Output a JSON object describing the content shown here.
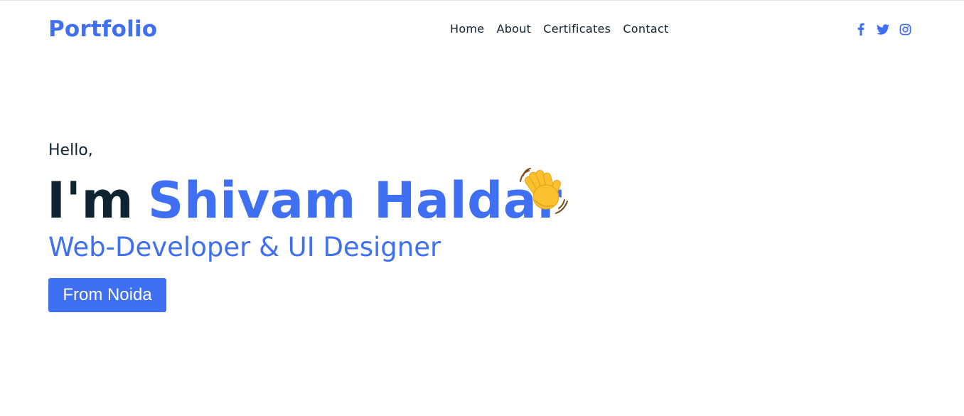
{
  "header": {
    "logo": "Portfolio",
    "nav": [
      "Home",
      "About",
      "Certificates",
      "Contact"
    ],
    "socials": [
      "facebook-icon",
      "twitter-icon",
      "instagram-icon"
    ]
  },
  "hero": {
    "hello": "Hello,",
    "greet": "I'm",
    "name": "Shivam Haldar",
    "emoji": "waving-hand",
    "role": "Web-Developer & UI Designer",
    "button": "From Noida"
  },
  "colors": {
    "accent": "#3f6ff2",
    "text": "#0e2431",
    "background": "#ffffff"
  }
}
